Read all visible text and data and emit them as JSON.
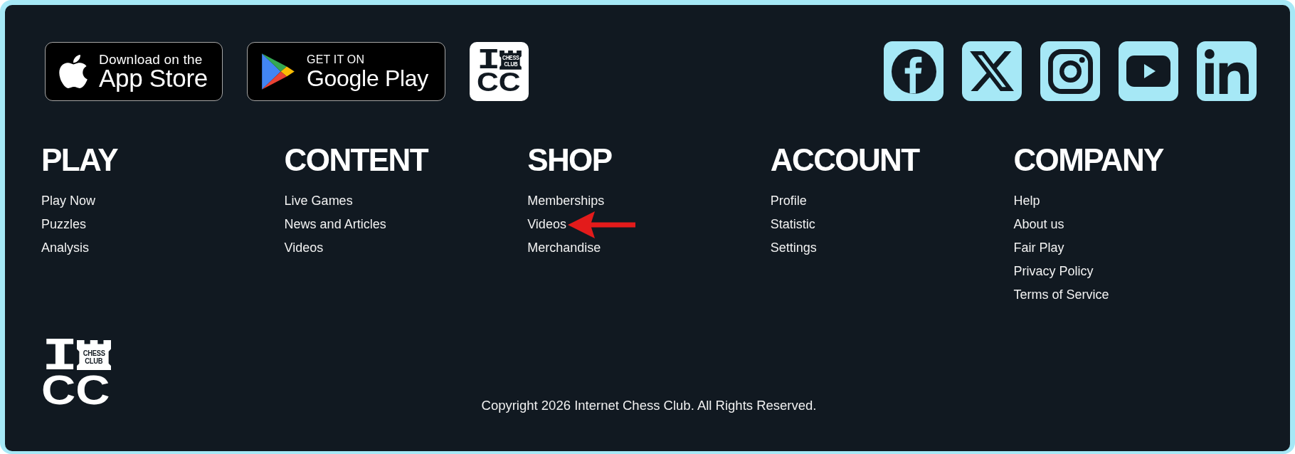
{
  "store_badges": [
    {
      "kind": "apple",
      "caption": "Download on the",
      "store": "App Store"
    },
    {
      "kind": "google",
      "caption": "GET IT ON",
      "store": "Google Play"
    }
  ],
  "app_tile": {
    "letter": "I",
    "emblem_lines": [
      "CHESS",
      "CLUB"
    ],
    "initials": "CC"
  },
  "social_links": [
    {
      "kind": "facebook"
    },
    {
      "kind": "x"
    },
    {
      "kind": "instagram"
    },
    {
      "kind": "youtube"
    },
    {
      "kind": "linkedin"
    }
  ],
  "columns": [
    {
      "heading": "PLAY",
      "links": [
        {
          "label": "Play Now",
          "annotated": false
        },
        {
          "label": "Puzzles",
          "annotated": false
        },
        {
          "label": "Analysis",
          "annotated": false
        }
      ]
    },
    {
      "heading": "CONTENT",
      "links": [
        {
          "label": "Live Games",
          "annotated": false
        },
        {
          "label": "News and Articles",
          "annotated": false
        },
        {
          "label": "Videos",
          "annotated": false
        }
      ]
    },
    {
      "heading": "SHOP",
      "links": [
        {
          "label": "Memberships",
          "annotated": false
        },
        {
          "label": "Videos",
          "annotated": true
        },
        {
          "label": "Merchandise",
          "annotated": false
        }
      ]
    },
    {
      "heading": "ACCOUNT",
      "links": [
        {
          "label": "Profile",
          "annotated": false
        },
        {
          "label": "Statistic",
          "annotated": false
        },
        {
          "label": "Settings",
          "annotated": false
        }
      ]
    },
    {
      "heading": "COMPANY",
      "links": [
        {
          "label": "Help",
          "annotated": false
        },
        {
          "label": "About us",
          "annotated": false
        },
        {
          "label": "Fair Play",
          "annotated": false
        },
        {
          "label": "Privacy Policy",
          "annotated": false
        },
        {
          "label": "Terms of Service",
          "annotated": false
        }
      ]
    }
  ],
  "footer_logo": {
    "letter": "I",
    "emblem_lines": [
      "CHESS",
      "CLUB"
    ],
    "initials": "CC"
  },
  "copyright": "Copyright 2026 Internet Chess Club. All Rights Reserved."
}
